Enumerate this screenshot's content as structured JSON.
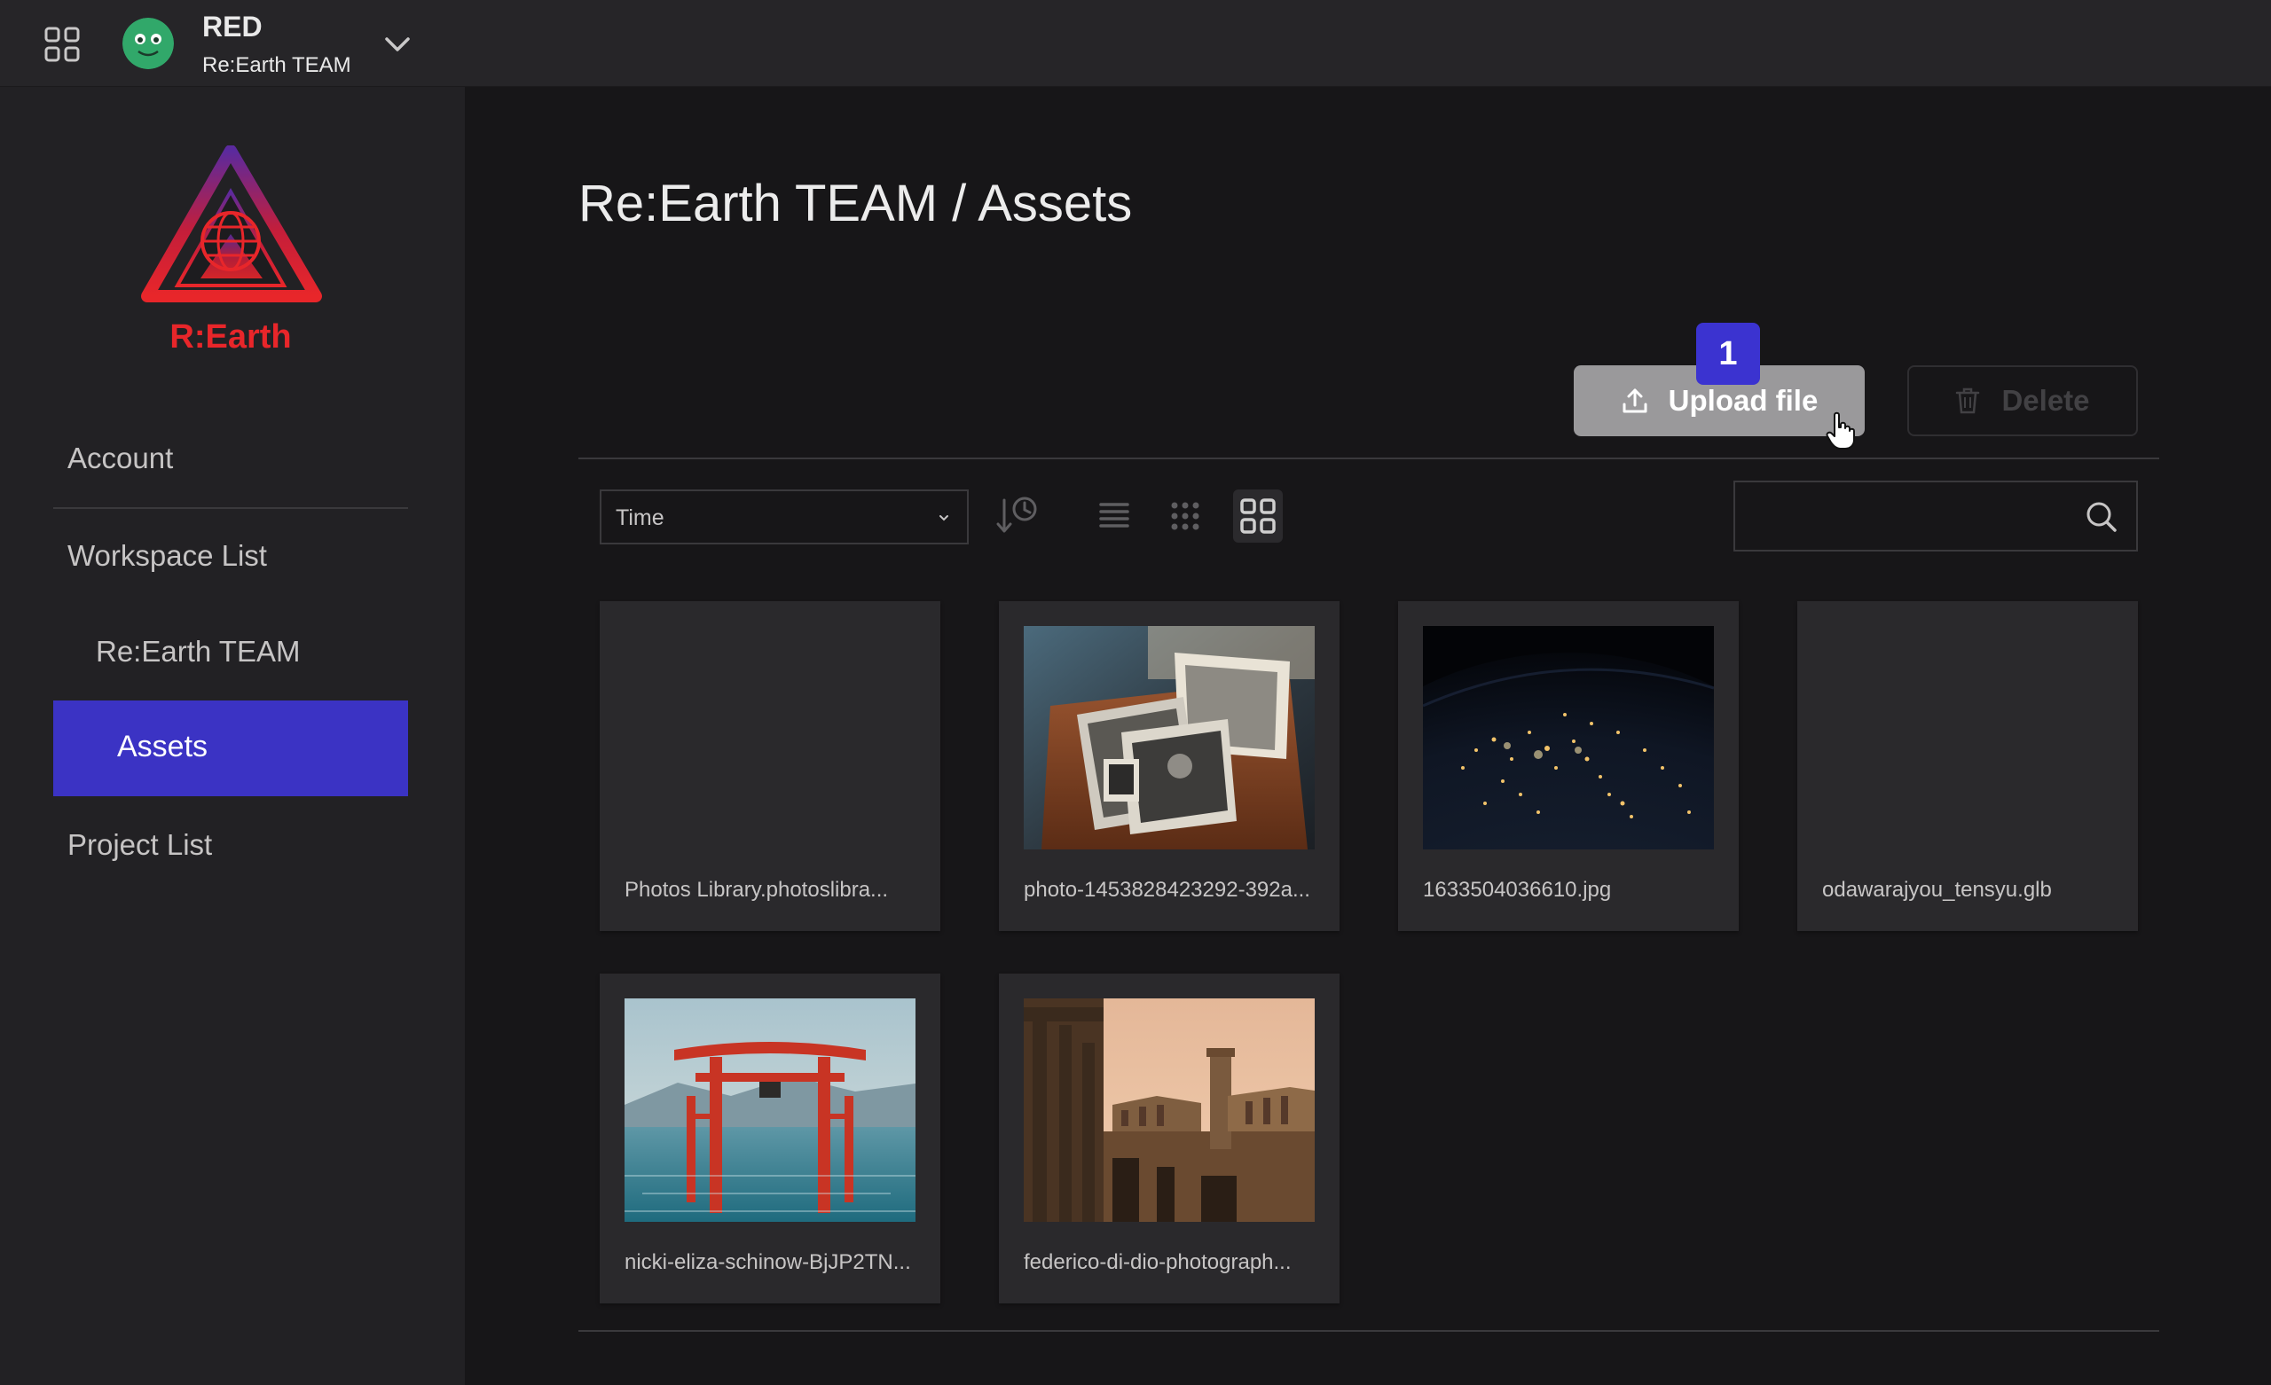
{
  "header": {
    "user_name": "RED",
    "workspace_name": "Re:Earth TEAM"
  },
  "sidebar": {
    "logo_text": "R:Earth",
    "items": [
      {
        "label": "Account"
      },
      {
        "label": "Workspace List"
      },
      {
        "label": "Re:Earth TEAM"
      },
      {
        "label": "Assets"
      },
      {
        "label": "Project List"
      }
    ],
    "active_color": "#3b33c4"
  },
  "main": {
    "title": "Re:Earth TEAM / Assets",
    "badge": "1",
    "upload_label": "Upload file",
    "delete_label": "Delete",
    "sort_value": "Time",
    "search_value": "",
    "assets": [
      {
        "name": "Photos Library.photoslibra..."
      },
      {
        "name": "photo-1453828423292-392a..."
      },
      {
        "name": "1633504036610.jpg"
      },
      {
        "name": "odawarajyou_tensyu.glb"
      },
      {
        "name": "nicki-eliza-schinow-BjJP2TN..."
      },
      {
        "name": "federico-di-dio-photograph..."
      }
    ]
  },
  "colors": {
    "background": "#171618",
    "header": "#262528",
    "sidebar": "#222124",
    "card": "#2a292c",
    "accent": "#3b33c4"
  },
  "icons": [
    "apps-grid-icon",
    "avatar-icon",
    "chevron-down-icon",
    "upload-icon",
    "trash-icon",
    "sort-time-icon",
    "list-view-icon",
    "dots-grid-view-icon",
    "large-grid-view-icon",
    "search-icon",
    "pointer-cursor-icon"
  ]
}
